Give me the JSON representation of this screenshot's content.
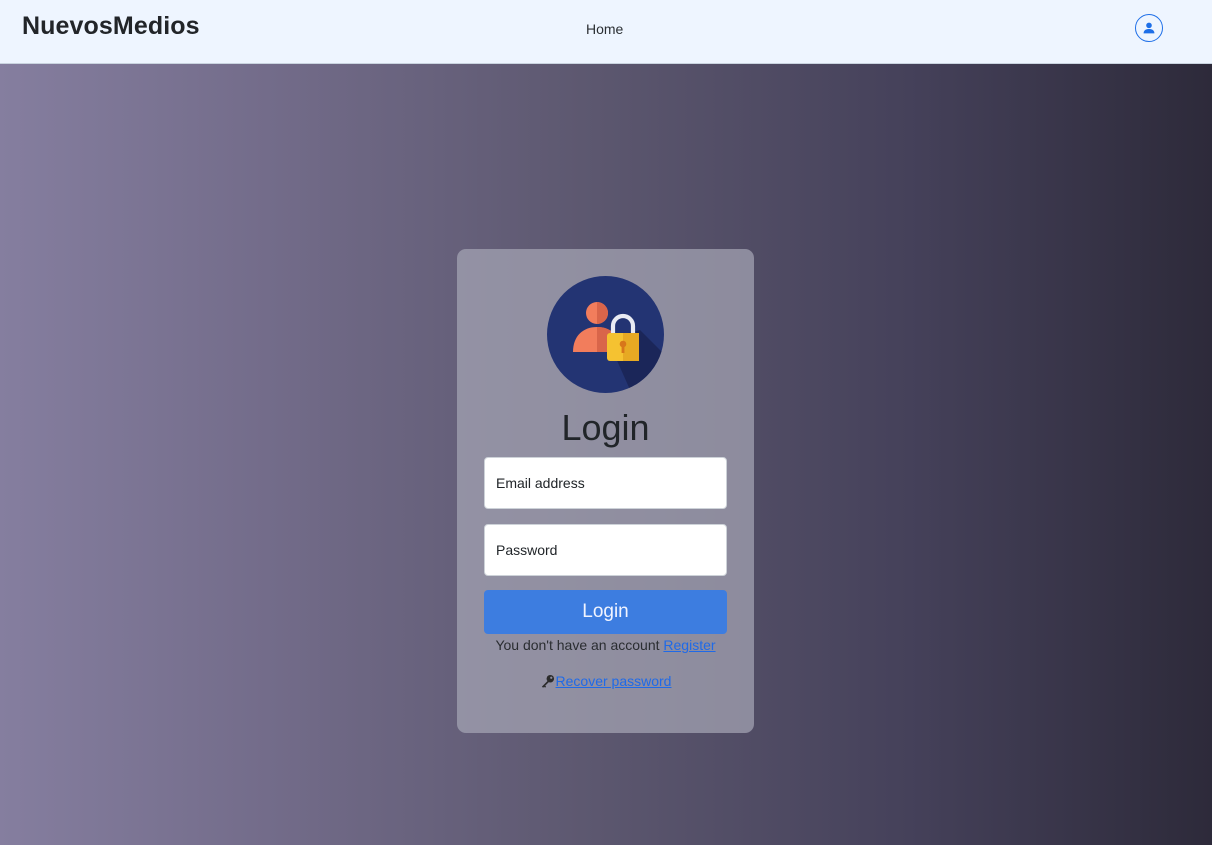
{
  "navbar": {
    "brand": "NuevosMedios",
    "home_link": "Home",
    "user_icon": "user-circle-icon"
  },
  "login_card": {
    "avatar_icon": "user-lock-icon",
    "title": "Login",
    "email_placeholder": "Email address",
    "password_placeholder": "Password",
    "submit_label": "Login",
    "register_prompt": "You don't have an account",
    "register_link": "Register",
    "recover_icon": "key-icon",
    "recover_link": "Recover password"
  },
  "colors": {
    "navbar_bg": "#eef5ff",
    "accent": "#3d7de0",
    "link": "#1f6ae8",
    "avatar_circle": "#233473",
    "avatar_person": "#f27d5c",
    "avatar_lock": "#f5c231"
  }
}
